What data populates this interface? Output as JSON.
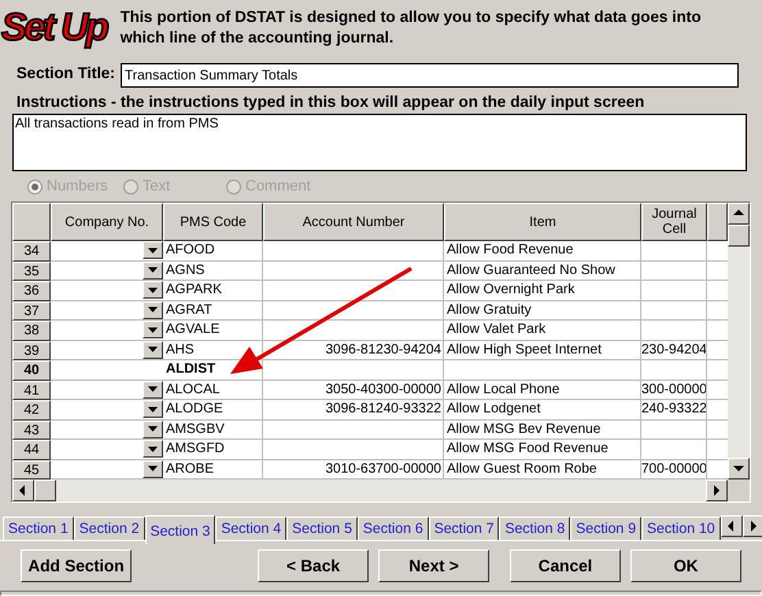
{
  "header": {
    "logo": "Set Up",
    "description": "This portion of DSTAT is designed to allow you to specify what data goes into which line of the accounting journal."
  },
  "section_title": {
    "label": "Section Title:",
    "value": "Transaction Summary Totals"
  },
  "instructions": {
    "label": "Instructions - the instructions typed in this box will appear on the daily input screen",
    "value": "All transactions read in from PMS"
  },
  "data_type": [
    {
      "label": "Numbers",
      "selected": true,
      "disabled": true
    },
    {
      "label": "Text",
      "selected": false,
      "disabled": true
    },
    {
      "label": "Comment",
      "selected": false,
      "disabled": true
    }
  ],
  "table": {
    "columns": [
      "Company No.",
      "PMS Code",
      "Account Number",
      "Item",
      "Journal Cell"
    ],
    "rows": [
      {
        "number": "34",
        "kind": "item",
        "pms_code": "AFOOD",
        "account": "",
        "item": "Allow Food Revenue",
        "journal_cell": ""
      },
      {
        "number": "35",
        "kind": "item",
        "pms_code": "AGNS",
        "account": "",
        "item": "Allow Guaranteed No Show",
        "journal_cell": ""
      },
      {
        "number": "36",
        "kind": "item",
        "pms_code": "AGPARK",
        "account": "",
        "item": "Allow Overnight Park",
        "journal_cell": ""
      },
      {
        "number": "37",
        "kind": "item",
        "pms_code": "AGRAT",
        "account": "",
        "item": "Allow Gratuity",
        "journal_cell": ""
      },
      {
        "number": "38",
        "kind": "item",
        "pms_code": "AGVALE",
        "account": "",
        "item": "Allow Valet Park",
        "journal_cell": ""
      },
      {
        "number": "39",
        "kind": "item",
        "pms_code": "AHS",
        "account": "3096-81230-94204",
        "item": "Allow High Speet Internet",
        "journal_cell": "230-94204"
      },
      {
        "number": "40",
        "kind": "heading",
        "pms_code": "ALDIST",
        "account": "",
        "item": "",
        "journal_cell": ""
      },
      {
        "number": "41",
        "kind": "item",
        "pms_code": "ALOCAL",
        "account": "3050-40300-00000",
        "item": "Allow Local Phone",
        "journal_cell": "300-00000"
      },
      {
        "number": "42",
        "kind": "item",
        "pms_code": "ALODGE",
        "account": "3096-81240-93322",
        "item": "Allow Lodgenet",
        "journal_cell": "240-93322"
      },
      {
        "number": "43",
        "kind": "item",
        "pms_code": "AMSGBV",
        "account": "",
        "item": "Allow MSG Bev Revenue",
        "journal_cell": ""
      },
      {
        "number": "44",
        "kind": "item",
        "pms_code": "AMSGFD",
        "account": "",
        "item": "Allow MSG Food Revenue",
        "journal_cell": ""
      },
      {
        "number": "45",
        "kind": "item",
        "pms_code": "AROBE",
        "account": "3010-63700-00000",
        "item": "Allow Guest Room Robe",
        "journal_cell": "700-00000"
      }
    ]
  },
  "tabs": [
    {
      "label": "Section 1",
      "selected": false
    },
    {
      "label": "Section 2",
      "selected": false
    },
    {
      "label": "Section 3",
      "selected": true
    },
    {
      "label": "Section 4",
      "selected": false
    },
    {
      "label": "Section 5",
      "selected": false
    },
    {
      "label": "Section 6",
      "selected": false
    },
    {
      "label": "Section 7",
      "selected": false
    },
    {
      "label": "Section 8",
      "selected": false
    },
    {
      "label": "Section 9",
      "selected": false
    },
    {
      "label": "Section 10",
      "selected": false
    }
  ],
  "buttons": {
    "add": "Add Section",
    "back": "< Back",
    "next": "Next >",
    "cancel": "Cancel",
    "ok": "OK"
  }
}
